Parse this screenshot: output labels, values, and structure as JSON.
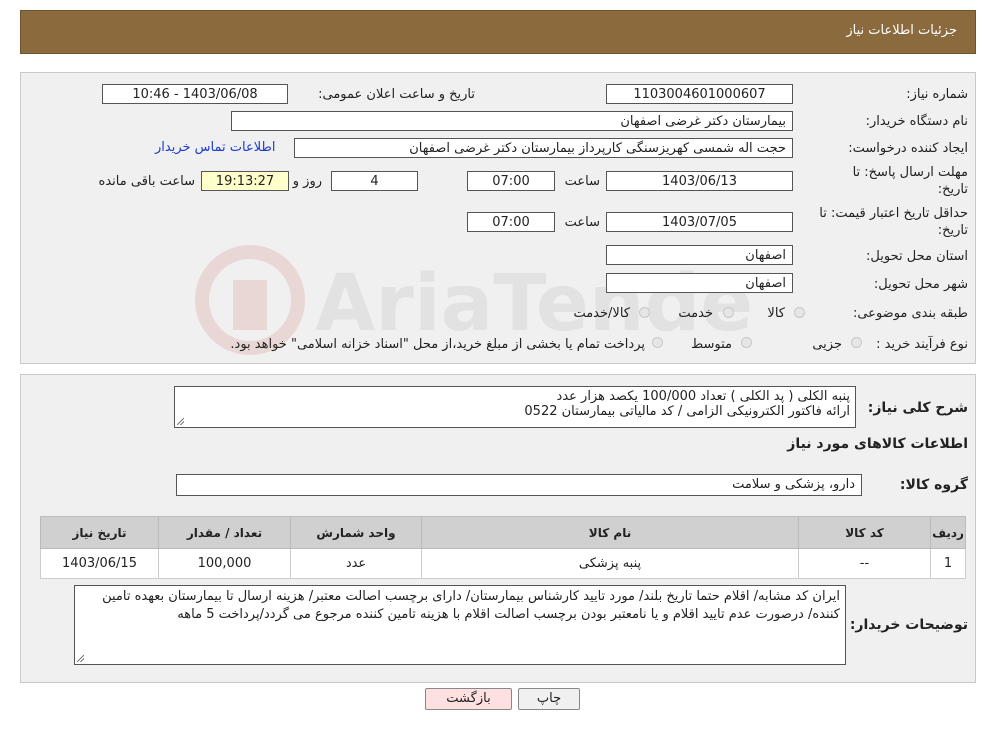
{
  "header": {
    "title": "جزئیات اطلاعات نیاز"
  },
  "form": {
    "need_number_label": "شماره نیاز:",
    "need_number": "1103004601000607",
    "announce_label": "تاریخ و ساعت اعلان عمومی:",
    "announce_value": "1403/06/08 - 10:46",
    "buyer_org_label": "نام دستگاه خریدار:",
    "buyer_org": "بیمارستان دکتر غرضی اصفهان",
    "requester_label": "ایجاد کننده درخواست:",
    "requester": "حجت اله شمسی کهریزسنگی کارپرداز بیمارستان دکتر غرضی اصفهان",
    "contact_link": "اطلاعات تماس خریدار",
    "reply_deadline_label_1": "مهلت ارسال پاسخ: تا",
    "reply_deadline_label_2": "تاریخ:",
    "reply_date": "1403/06/13",
    "time_label": "ساعت",
    "reply_time": "07:00",
    "days_value": "4",
    "days_label": "روز و",
    "remaining_time": "19:13:27",
    "remaining_label": "ساعت باقی مانده",
    "price_valid_label_1": "حداقل تاریخ اعتبار قیمت: تا",
    "price_valid_label_2": "تاریخ:",
    "price_valid_date": "1403/07/05",
    "price_valid_time": "07:00",
    "province_label": "استان محل تحویل:",
    "province": "اصفهان",
    "city_label": "شهر محل تحویل:",
    "city": "اصفهان",
    "category_label": "طبقه بندی موضوعی:",
    "category_options": [
      "کالا",
      "خدمت",
      "کالا/خدمت"
    ],
    "process_label": "نوع فرآیند خرید :",
    "process_options": [
      "جزیی",
      "متوسط"
    ],
    "process_note": "پرداخت تمام یا بخشی از مبلغ خرید،از محل \"اسناد خزانه اسلامی\" خواهد بود."
  },
  "summary": {
    "label": "شرح کلی نیاز:",
    "line1": "پنبه الکلی ( پد الکلی )  تعداد 100/000 یکصد هزار عدد",
    "line2": "ارائه فاکتور الکترونیکی الزامی / کد مالیاتی بیمارستان 0522"
  },
  "goods": {
    "title": "اطلاعات کالاهای مورد نیاز",
    "group_label": "گروه کالا:",
    "group_value": "دارو، پزشکی و سلامت"
  },
  "table": {
    "headers": [
      "ردیف",
      "کد کالا",
      "نام کالا",
      "واحد شمارش",
      "تعداد / مقدار",
      "تاریخ نیاز"
    ],
    "rows": [
      [
        "1",
        "--",
        "پنبه پزشکی",
        "عدد",
        "100,000",
        "1403/06/15"
      ]
    ]
  },
  "buyer_notes": {
    "label": "توضیحات خریدار:",
    "text": "ایران کد مشابه/ اقلام حتما تاریخ بلند/ مورد تایید کارشناس بیمارستان/ دارای برچسب اصالت معتبر/ هزینه ارسال تا بیمارستان بعهده تامین کننده/ درصورت عدم تایید اقلام و یا نامعتبر بودن برچسب اصالت اقلام با هزینه تامین کننده مرجوع می گردد/پرداخت 5 ماهه"
  },
  "buttons": {
    "print": "چاپ",
    "back": "بازگشت"
  },
  "colors": {
    "header_bg": "#8b6a3e",
    "panel_bg": "#f0f0f0",
    "link": "#1a3ccc",
    "back_btn": "#ffe0e0"
  }
}
